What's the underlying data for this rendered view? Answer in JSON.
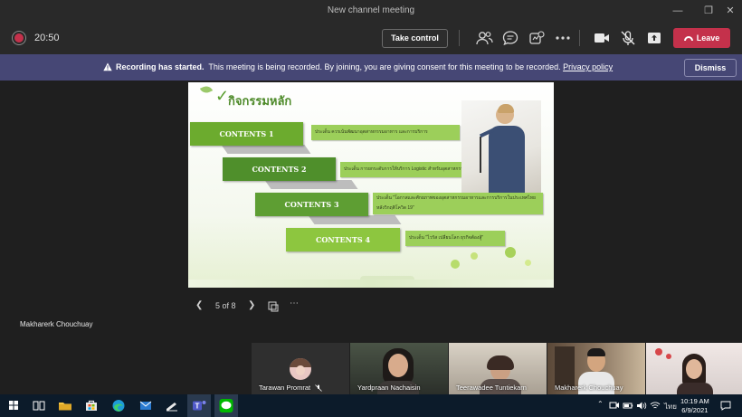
{
  "window": {
    "title": "New channel meeting"
  },
  "controls": {
    "timer": "20:50",
    "take_control": "Take control",
    "leave": "Leave"
  },
  "banner": {
    "heading": "Recording has started.",
    "message": "This meeting is being recorded. By joining, you are giving consent for this meeting to be recorded.",
    "link": "Privacy policy",
    "dismiss": "Dismiss"
  },
  "slide": {
    "title": "กิจกรรมหลัก",
    "contents": [
      {
        "label": "CONTENTS 1",
        "desc": "ประเด็น ควรเน้นพัฒนาอุตสาหกรรมอาหาร และการบริการ"
      },
      {
        "label": "CONTENTS 2",
        "desc": "ประเด็น การยกระดับการให้บริการ Logistic สำหรับอุตสาหกรรมอาหาร"
      },
      {
        "label": "CONTENTS 3",
        "desc": "ประเด็น \"โอกาสและศักยภาพของอุตสาหกรรมอาหารและการบริการในประเทศไทย หลังวิกฤติโควิด 19\""
      },
      {
        "label": "CONTENTS 4",
        "desc": "ประเด็น \"ไวรัส เปลี่ยนโลก ธุรกิจต้องสู้\""
      }
    ],
    "page_indicator": "5 of 8",
    "presenter": "Makharerk Chouchuay"
  },
  "participants": [
    {
      "name": "Tarawan Promrat"
    },
    {
      "name": "Yardpraan Nachaisin"
    },
    {
      "name": "Teerawadee Tuntiekarn"
    },
    {
      "name": "Makharerk Chouchuay"
    },
    {
      "name": ""
    }
  ],
  "taskbar": {
    "lang": "ไทย",
    "time": "10:19 AM",
    "date": "6/9/2021"
  },
  "colors": {
    "leave": "#c4314b",
    "banner": "#464775",
    "contents_dark": "#4f8f2b",
    "contents_light": "#8dc63f"
  }
}
